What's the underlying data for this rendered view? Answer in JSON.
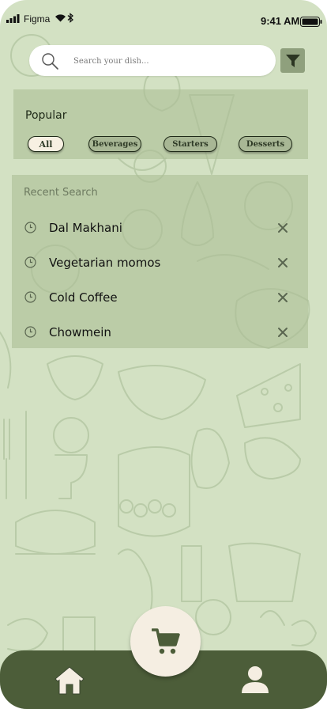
{
  "status_bar": {
    "carrier": "Figma",
    "time": "9:41 AM"
  },
  "search": {
    "placeholder": "Search your dish..."
  },
  "icons": {
    "search": "search-icon",
    "filter": "filter-icon",
    "clock": "clock-icon",
    "remove": "close-icon",
    "home": "home-icon",
    "cart": "cart-icon",
    "profile": "user-icon"
  },
  "popular": {
    "title": "Popular",
    "chips": [
      {
        "label": "All",
        "selected": true
      },
      {
        "label": "Beverages",
        "selected": false
      },
      {
        "label": "Starters",
        "selected": false
      },
      {
        "label": "Desserts",
        "selected": false
      }
    ]
  },
  "recent": {
    "title": "Recent Search",
    "items": [
      {
        "label": "Dal Makhani"
      },
      {
        "label": "Vegetarian momos"
      },
      {
        "label": "Cold Coffee"
      },
      {
        "label": "Chowmein"
      }
    ]
  },
  "colors": {
    "background": "#d3e1c3",
    "panel": "#acbe96",
    "tab_bar": "#4c5d39",
    "cart_button": "#f5eee2",
    "chip_active": "#f7f0e2"
  }
}
